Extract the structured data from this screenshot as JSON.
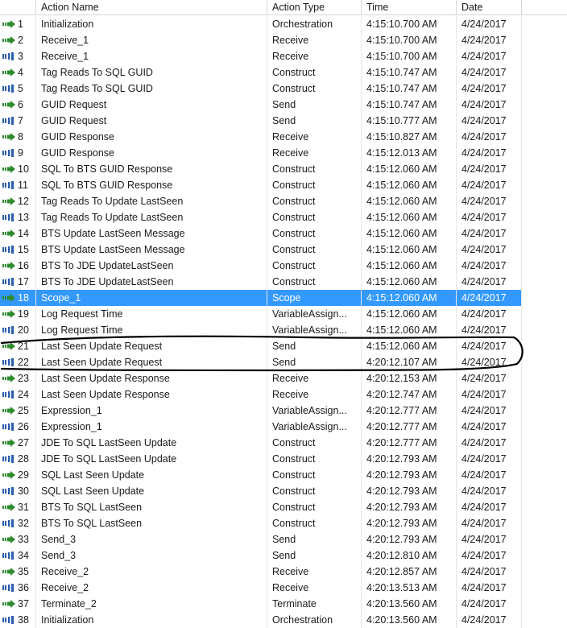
{
  "columns": {
    "num": "",
    "name": "Action Name",
    "type": "Action Type",
    "time": "Time",
    "date": "Date"
  },
  "colors": {
    "selection": "#3399ff",
    "arrow_icon": "#2e8b2e",
    "bars_icon": "#2a5db0",
    "annotation": "#000000"
  },
  "selected_row": 18,
  "rows": [
    {
      "n": "1",
      "name": "Initialization",
      "type": "Orchestration",
      "time": "4:15:10.700 AM",
      "date": "4/24/2017",
      "icon": "arrow-right-icon"
    },
    {
      "n": "2",
      "name": "Receive_1",
      "type": "Receive",
      "time": "4:15:10.700 AM",
      "date": "4/24/2017",
      "icon": "arrow-right-icon"
    },
    {
      "n": "3",
      "name": "Receive_1",
      "type": "Receive",
      "time": "4:15:10.700 AM",
      "date": "4/24/2017",
      "icon": "bars-icon"
    },
    {
      "n": "4",
      "name": "Tag Reads To SQL GUID",
      "type": "Construct",
      "time": "4:15:10.747 AM",
      "date": "4/24/2017",
      "icon": "arrow-right-icon"
    },
    {
      "n": "5",
      "name": "Tag Reads To SQL GUID",
      "type": "Construct",
      "time": "4:15:10.747 AM",
      "date": "4/24/2017",
      "icon": "bars-icon"
    },
    {
      "n": "6",
      "name": "GUID Request",
      "type": "Send",
      "time": "4:15:10.747 AM",
      "date": "4/24/2017",
      "icon": "arrow-right-icon"
    },
    {
      "n": "7",
      "name": "GUID Request",
      "type": "Send",
      "time": "4:15:10.777 AM",
      "date": "4/24/2017",
      "icon": "bars-icon"
    },
    {
      "n": "8",
      "name": "GUID Response",
      "type": "Receive",
      "time": "4:15:10.827 AM",
      "date": "4/24/2017",
      "icon": "arrow-right-icon"
    },
    {
      "n": "9",
      "name": "GUID Response",
      "type": "Receive",
      "time": "4:15:12.013 AM",
      "date": "4/24/2017",
      "icon": "bars-icon"
    },
    {
      "n": "10",
      "name": "SQL To BTS GUID Response",
      "type": "Construct",
      "time": "4:15:12.060 AM",
      "date": "4/24/2017",
      "icon": "arrow-right-icon"
    },
    {
      "n": "11",
      "name": "SQL To BTS GUID Response",
      "type": "Construct",
      "time": "4:15:12.060 AM",
      "date": "4/24/2017",
      "icon": "bars-icon"
    },
    {
      "n": "12",
      "name": "Tag Reads To Update LastSeen",
      "type": "Construct",
      "time": "4:15:12.060 AM",
      "date": "4/24/2017",
      "icon": "arrow-right-icon"
    },
    {
      "n": "13",
      "name": "Tag Reads To Update LastSeen",
      "type": "Construct",
      "time": "4:15:12.060 AM",
      "date": "4/24/2017",
      "icon": "bars-icon"
    },
    {
      "n": "14",
      "name": "BTS Update LastSeen Message",
      "type": "Construct",
      "time": "4:15:12.060 AM",
      "date": "4/24/2017",
      "icon": "arrow-right-icon"
    },
    {
      "n": "15",
      "name": "BTS Update LastSeen Message",
      "type": "Construct",
      "time": "4:15:12.060 AM",
      "date": "4/24/2017",
      "icon": "bars-icon"
    },
    {
      "n": "16",
      "name": "BTS To JDE UpdateLastSeen",
      "type": "Construct",
      "time": "4:15:12.060 AM",
      "date": "4/24/2017",
      "icon": "arrow-right-icon"
    },
    {
      "n": "17",
      "name": "BTS To JDE UpdateLastSeen",
      "type": "Construct",
      "time": "4:15:12.060 AM",
      "date": "4/24/2017",
      "icon": "bars-icon"
    },
    {
      "n": "18",
      "name": "Scope_1",
      "type": "Scope",
      "time": "4:15:12.060 AM",
      "date": "4/24/2017",
      "icon": "arrow-right-icon"
    },
    {
      "n": "19",
      "name": "Log Request Time",
      "type": "VariableAssign...",
      "time": "4:15:12.060 AM",
      "date": "4/24/2017",
      "icon": "arrow-right-icon"
    },
    {
      "n": "20",
      "name": "Log Request Time",
      "type": "VariableAssign...",
      "time": "4:15:12.060 AM",
      "date": "4/24/2017",
      "icon": "bars-icon"
    },
    {
      "n": "21",
      "name": "Last Seen Update Request",
      "type": "Send",
      "time": "4:15:12.060 AM",
      "date": "4/24/2017",
      "icon": "arrow-right-icon"
    },
    {
      "n": "22",
      "name": "Last Seen Update Request",
      "type": "Send",
      "time": "4:20:12.107 AM",
      "date": "4/24/2017",
      "icon": "bars-icon"
    },
    {
      "n": "23",
      "name": "Last Seen Update Response",
      "type": "Receive",
      "time": "4:20:12.153 AM",
      "date": "4/24/2017",
      "icon": "arrow-right-icon"
    },
    {
      "n": "24",
      "name": "Last Seen Update Response",
      "type": "Receive",
      "time": "4:20:12.747 AM",
      "date": "4/24/2017",
      "icon": "bars-icon"
    },
    {
      "n": "25",
      "name": "Expression_1",
      "type": "VariableAssign...",
      "time": "4:20:12.777 AM",
      "date": "4/24/2017",
      "icon": "arrow-right-icon"
    },
    {
      "n": "26",
      "name": "Expression_1",
      "type": "VariableAssign...",
      "time": "4:20:12.777 AM",
      "date": "4/24/2017",
      "icon": "bars-icon"
    },
    {
      "n": "27",
      "name": "JDE To SQL LastSeen Update",
      "type": "Construct",
      "time": "4:20:12.777 AM",
      "date": "4/24/2017",
      "icon": "arrow-right-icon"
    },
    {
      "n": "28",
      "name": "JDE To SQL LastSeen Update",
      "type": "Construct",
      "time": "4:20:12.793 AM",
      "date": "4/24/2017",
      "icon": "bars-icon"
    },
    {
      "n": "29",
      "name": "SQL Last Seen Update",
      "type": "Construct",
      "time": "4:20:12.793 AM",
      "date": "4/24/2017",
      "icon": "arrow-right-icon"
    },
    {
      "n": "30",
      "name": "SQL Last Seen Update",
      "type": "Construct",
      "time": "4:20:12.793 AM",
      "date": "4/24/2017",
      "icon": "bars-icon"
    },
    {
      "n": "31",
      "name": "BTS To SQL LastSeen",
      "type": "Construct",
      "time": "4:20:12.793 AM",
      "date": "4/24/2017",
      "icon": "arrow-right-icon"
    },
    {
      "n": "32",
      "name": "BTS To SQL LastSeen",
      "type": "Construct",
      "time": "4:20:12.793 AM",
      "date": "4/24/2017",
      "icon": "bars-icon"
    },
    {
      "n": "33",
      "name": "Send_3",
      "type": "Send",
      "time": "4:20:12.793 AM",
      "date": "4/24/2017",
      "icon": "arrow-right-icon"
    },
    {
      "n": "34",
      "name": "Send_3",
      "type": "Send",
      "time": "4:20:12.810 AM",
      "date": "4/24/2017",
      "icon": "bars-icon"
    },
    {
      "n": "35",
      "name": "Receive_2",
      "type": "Receive",
      "time": "4:20:12.857 AM",
      "date": "4/24/2017",
      "icon": "arrow-right-icon"
    },
    {
      "n": "36",
      "name": "Receive_2",
      "type": "Receive",
      "time": "4:20:13.513 AM",
      "date": "4/24/2017",
      "icon": "bars-icon"
    },
    {
      "n": "37",
      "name": "Terminate_2",
      "type": "Terminate",
      "time": "4:20:13.560 AM",
      "date": "4/24/2017",
      "icon": "arrow-right-icon"
    },
    {
      "n": "38",
      "name": "Initialization",
      "type": "Orchestration",
      "time": "4:20:13.560 AM",
      "date": "4/24/2017",
      "icon": "bars-icon"
    }
  ]
}
